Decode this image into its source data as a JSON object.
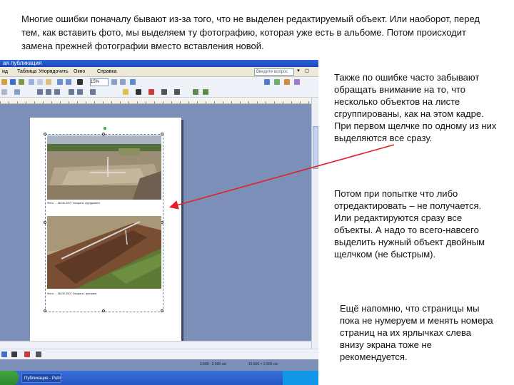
{
  "slide": {
    "intro": "Многие ошибки поначалу бывают из-за того, что не выделен редактируемый объект. Или наоборот, перед тем, как вставить фото, мы выделяем ту фотографию, которая уже есть в альбоме. Потом происходит замена прежней фотографии вместо вставления новой.",
    "note1": "Также по ошибке часто забывают обращать внимание на то, что несколько объектов на листе сгруппированы, как на этом кадре. При первом щелчке по одному из них выделяются все сразу.",
    "note2": "Потом при попытке что либо отредактировать – не получается. Или редактируются сразу все объекты. А надо то всего-навсего выделить нужный объект двойным щелчком (не быстрым).",
    "note3": "Ещё напомню, что страницы мы пока не нумеруем и менять номера страниц на их ярлычках слева внизу экрана тоже не рекомендуется.",
    "arrow_color": "#e41e26"
  },
  "app": {
    "title": "ая публикация",
    "menu": {
      "view": "ид",
      "table": "Таблица",
      "arrange": "Упорядочить",
      "window": "Окно",
      "help": "Справка"
    },
    "help_placeholder": "Введите вопрос",
    "zoom": "15%",
    "caption1": "Фото ... 06.08.2007 Хвориги, фундамент",
    "caption2": "Фото ... 06.08.2007 Хвориги, траншея",
    "coords_left": "2,600 ; 2,500 см",
    "coords_right": "15,600 × 2,500 см",
    "task_label": "Публикация - Publisher",
    "colors": {
      "background": "#7c8fb8",
      "titlebar": "#2c63d6",
      "taskbar": "#2457c4",
      "selection": "#6b7fb0"
    }
  }
}
